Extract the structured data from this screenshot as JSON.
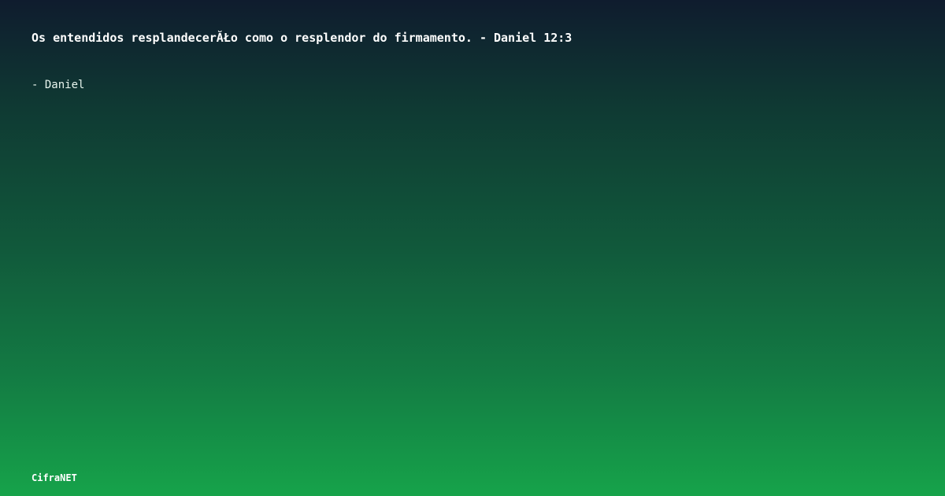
{
  "card": {
    "quote": "Os entendidos resplandecerĂŁo como o resplendor do firmamento. - Daniel 12:3",
    "author": "- Daniel",
    "brand": "CifraNET"
  },
  "colors": {
    "gradient_top": "#0f1c2e",
    "gradient_bottom": "#16a34a",
    "text": "#ffffff"
  }
}
